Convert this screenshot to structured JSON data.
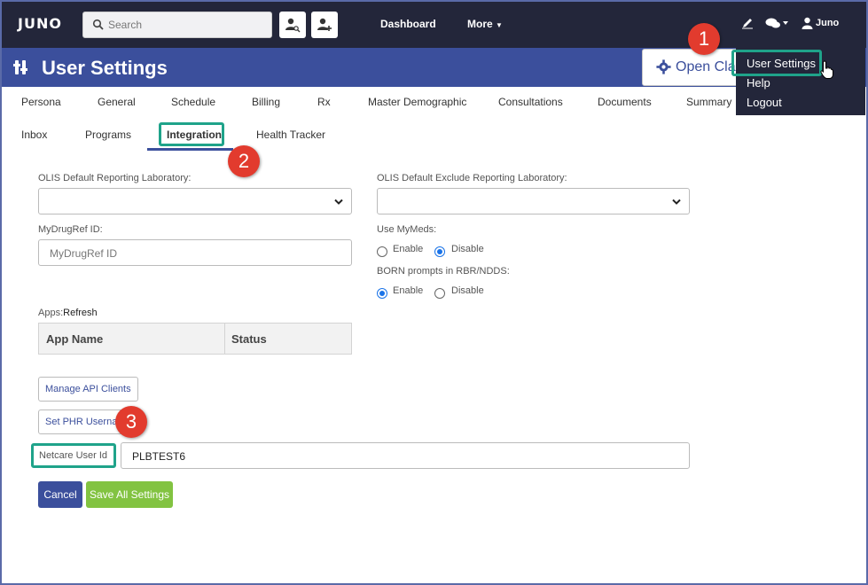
{
  "topbar": {
    "logo": "JUNO",
    "search_placeholder": "Search",
    "nav": {
      "dashboard": "Dashboard",
      "more": "More"
    },
    "user": "Juno",
    "bg_color": "#23263a"
  },
  "header": {
    "title": "User Settings",
    "open_class_button": "Open Cla",
    "bg_color": "#3b4f9c"
  },
  "dropdown": {
    "items": [
      "User Settings",
      "Help",
      "Logout"
    ]
  },
  "tabs": {
    "row1": [
      "Persona",
      "General",
      "Schedule",
      "Billing",
      "Rx",
      "Master Demographic",
      "Consultations",
      "Documents",
      "Summary"
    ],
    "row2": [
      "Inbox",
      "Programs",
      "Integration",
      "Health Tracker"
    ],
    "active": "Integration"
  },
  "callouts": [
    "1",
    "2",
    "3"
  ],
  "form": {
    "olis_default_label": "OLIS Default Reporting Laboratory:",
    "olis_exclude_label": "OLIS Default Exclude Reporting Laboratory:",
    "mydrugref_label": "MyDrugRef ID:",
    "mydrugref_placeholder": "MyDrugRef ID",
    "use_mymeds_label": "Use MyMeds:",
    "use_mymeds_options": [
      "Enable",
      "Disable"
    ],
    "use_mymeds_selected": "Disable",
    "born_label": "BORN prompts in RBR/NDDS:",
    "born_options": [
      "Enable",
      "Disable"
    ],
    "born_selected": "Enable",
    "apps_label": "Apps:",
    "apps_refresh": "Refresh",
    "apps_columns": [
      "App Name",
      "Status"
    ],
    "manage_api_button": "Manage API Clients",
    "set_phr_button": "Set PHR Userna",
    "netcare_label": "Netcare User Id",
    "netcare_value": "PLBTEST6",
    "cancel_button": "Cancel",
    "save_button": "Save All Settings"
  },
  "colors": {
    "highlight": "#1fa38a",
    "callout": "#e23b2e",
    "save": "#82c341",
    "primary": "#3b4f9c"
  }
}
